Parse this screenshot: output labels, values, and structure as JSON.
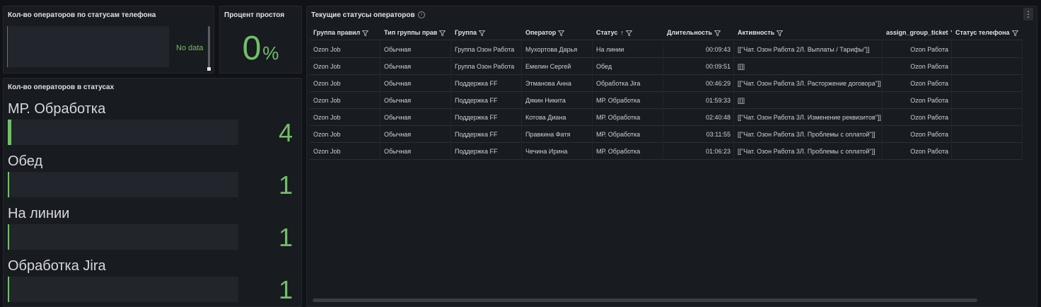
{
  "panel_phone": {
    "title": "Кол-во операторов по статусам телефона",
    "no_data": "No data"
  },
  "panel_idle": {
    "title": "Процент простоя",
    "value": "0",
    "unit": "%",
    "color": "#73bf69"
  },
  "panel_status": {
    "title": "Кол-во операторов в статусах",
    "max": 4,
    "items": [
      {
        "name": "МР. Обработка",
        "value": 4
      },
      {
        "name": "Обед",
        "value": 1
      },
      {
        "name": "На линии",
        "value": 1
      },
      {
        "name": "Обработка Jira",
        "value": 1
      }
    ]
  },
  "panel_table": {
    "title": "Текущие статусы операторов",
    "info_icon": "info-icon",
    "columns": [
      {
        "label": "Группа правил",
        "filter": true,
        "sort": ""
      },
      {
        "label": "Тип группы прав",
        "filter": true,
        "sort": ""
      },
      {
        "label": "Группа",
        "filter": true,
        "sort": ""
      },
      {
        "label": "Оператор",
        "filter": true,
        "sort": ""
      },
      {
        "label": "Статус",
        "filter": true,
        "sort": "↑"
      },
      {
        "label": "Длительность",
        "filter": true,
        "sort": ""
      },
      {
        "label": "Активность",
        "filter": true,
        "sort": ""
      },
      {
        "label": "assign_group_ticket",
        "filter": true,
        "sort": ""
      },
      {
        "label": "Статус телефона",
        "filter": true,
        "sort": ""
      }
    ],
    "rows": [
      [
        "Ozon Job",
        "Обычная",
        "Группа Озон Работа",
        "Мухортова Дарья",
        "На линии",
        "00:09:43",
        "[[\"Чат. Озон Работа 2Л. Выплаты / Тарифы\"]]",
        "Ozon Работа",
        ""
      ],
      [
        "Ozon Job",
        "Обычная",
        "Группа Озон Работа",
        "Емелин Сергей",
        "Обед",
        "00:09:51",
        "[[]]",
        "Ozon Работа",
        ""
      ],
      [
        "Ozon Job",
        "Обычная",
        "Поддержка FF",
        "Этманова Анна",
        "Обработка Jira",
        "00:46:29",
        "[[\"Чат. Озон Работа 3Л. Расторжение договора\"]]",
        "Ozon Работа",
        ""
      ],
      [
        "Ozon Job",
        "Обычная",
        "Поддержка FF",
        "Дякин Никита",
        "МР. Обработка",
        "01:59:33",
        "[[]]",
        "Ozon Работа",
        ""
      ],
      [
        "Ozon Job",
        "Обычная",
        "Поддержка FF",
        "Котова Диана",
        "МР. Обработка",
        "02:40:48",
        "[[\"Чат. Озон Работа 3Л. Изменение реквизитов\"]]",
        "Ozon Работа",
        ""
      ],
      [
        "Ozon Job",
        "Обычная",
        "Поддержка FF",
        "Правкина Фатя",
        "МР. Обработка",
        "03:11:55",
        "[[\"Чат. Озон Работа 3Л. Проблемы с оплатой\"]]",
        "Ozon Работа",
        ""
      ],
      [
        "Ozon Job",
        "Обычная",
        "Поддержка FF",
        "Чечина Ирина",
        "МР. Обработка",
        "01:06:23",
        "[[\"Чат. Озон Работа 3Л. Проблемы с оплатой\"]]",
        "Ozon Работа",
        ""
      ]
    ]
  },
  "colors": {
    "background": "#111217",
    "panel": "#181b1f",
    "accent_green": "#73bf69",
    "bar_bg": "#22252b"
  }
}
